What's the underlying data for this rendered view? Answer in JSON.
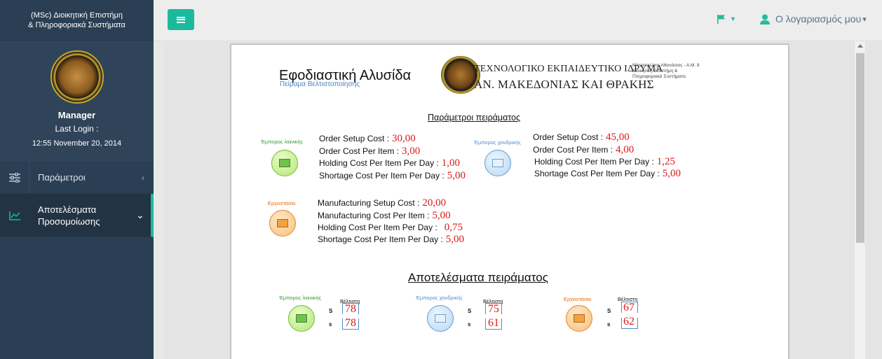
{
  "app": {
    "brand_line1": "(MSc) Διοικητική Επιστήμη",
    "brand_line2": "& Πληροφοριακά Συστήματα"
  },
  "profile": {
    "name": "Manager",
    "last_login_label": "Last Login :",
    "last_login_time": "12:55 November 20, 2014"
  },
  "sidebar": {
    "items": [
      {
        "label": "Παράμετροι",
        "icon": "sliders-icon",
        "caret": "‹"
      },
      {
        "label_line1": "Αποτελέσματα",
        "label_line2": "Προσομοίωσης",
        "icon": "line-chart-icon",
        "caret": "⌄"
      }
    ]
  },
  "topnav": {
    "toggle_icon": "menu-icon",
    "flag_icon": "flag-icon",
    "account_label": "Ο λογαριασμός μου",
    "account_caret": "▾"
  },
  "doc": {
    "title": "Εφοδιαστική Αλυσίδα",
    "subtitle": "Πείραμα Βελτιστοποίησης",
    "inst_line1": "ΤΕΧΝΟΛΟΓΙΚΟ ΕΚΠΑΙΔΕΥΤΙΚΟ ΙΔΡΥΜΑ",
    "inst_line2": "ΑΝ. ΜΑΚΕΔΟΝΙΑΣ ΚΑΙ ΘΡΑΚΗΣ",
    "note_line1": "Μπεστσιώτης Αθανάσιος - Α.Μ. 8",
    "note_line2": "Διοικητική Επιστήμη &",
    "note_line3": "Πληροφοριακά Συστήματα",
    "params_title": "Παράμετροι πειράματος",
    "results_title": "Αποτελέσματα πειράματος",
    "retailer_label": "Έμπορος λιανικής",
    "wholesaler_label": "Έμπορος χονδρικής",
    "factory_label": "Εργοστάσιο",
    "retailer": {
      "p1": "Order Setup Cost :",
      "v1": "30,00",
      "p2": "Order Cost Per Item :",
      "v2": "3,00",
      "p3": "Holding Cost Per Item Per Day :",
      "v3": "1,00",
      "p4": "Shortage Cost Per Item Per Day :",
      "v4": "5,00"
    },
    "wholesaler": {
      "p1": "Order Setup Cost :",
      "v1": "45,00",
      "p2": "Order Cost Per Item :",
      "v2": "4,00",
      "p3": "Holding Cost Per Item Per Day :",
      "v3": "1,25",
      "p4": "Shortage Cost Per Item Per Day :",
      "v4": "5,00"
    },
    "factory": {
      "p1": "Manufacturing Setup Cost :",
      "v1": "20,00",
      "p2": "Manufacturing Cost Per Item :",
      "v2": "5,00",
      "p3": "Holding Cost Per Item Per Day :",
      "v3": "0,75",
      "p4": "Shortage Cost Per Item Per Day :",
      "v4": "5,00"
    },
    "results": {
      "optimal_label": "Βέλτιστη",
      "S_label": "S",
      "s_label": "s",
      "retailer": {
        "S": "78",
        "s": "78"
      },
      "wholesaler": {
        "S": "75",
        "s": "61"
      },
      "factory": {
        "S": "67",
        "s": "62"
      }
    }
  },
  "colors": {
    "accent": "#1abb9c",
    "sidebar_bg": "#2a3f54",
    "value_red": "#e01818"
  }
}
